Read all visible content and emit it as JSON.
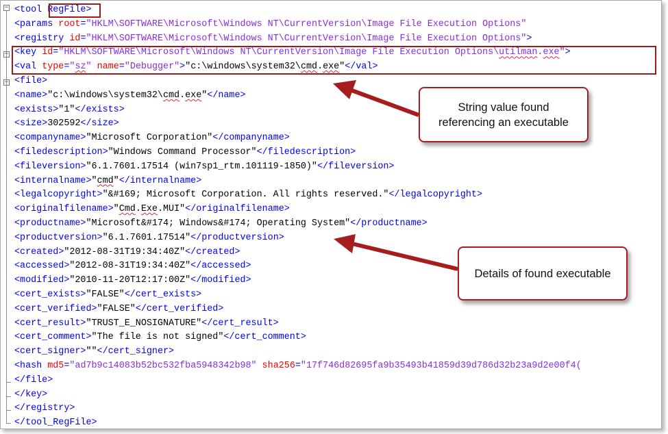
{
  "lines": [
    [
      [
        "t",
        "<tool "
      ],
      [
        "hl",
        "RegFile"
      ],
      [
        "t",
        ">"
      ]
    ],
    [
      [
        "t",
        "<params "
      ],
      [
        "a",
        "root"
      ],
      [
        "t",
        "="
      ],
      [
        "v",
        "\"HKLM\\SOFTWARE\\Microsoft\\Windows NT\\CurrentVersion\\Image File Execution Options\""
      ]
    ],
    [
      [
        "t",
        "<registry "
      ],
      [
        "a",
        "id"
      ],
      [
        "t",
        "="
      ],
      [
        "v",
        "\"HKLM\\SOFTWARE\\Microsoft\\Windows NT\\CurrentVersion\\Image File Execution Options\""
      ],
      [
        "t",
        ">"
      ]
    ],
    [
      [
        "t",
        "<key "
      ],
      [
        "a",
        "id"
      ],
      [
        "t",
        "="
      ],
      [
        "v",
        "\"HKLM\\SOFTWARE\\Microsoft\\Windows NT\\CurrentVersion\\Image File Execution Options\\"
      ],
      [
        "vw",
        "utilman"
      ],
      [
        "v",
        "."
      ],
      [
        "vw",
        "exe"
      ],
      [
        "v",
        "\""
      ],
      [
        "t",
        ">"
      ]
    ],
    [
      [
        "t",
        "<val "
      ],
      [
        "a",
        "type"
      ],
      [
        "t",
        "="
      ],
      [
        "v",
        "\""
      ],
      [
        "vw",
        "sz"
      ],
      [
        "v",
        "\" "
      ],
      [
        "a",
        "name"
      ],
      [
        "t",
        "="
      ],
      [
        "v",
        "\"Debugger\""
      ],
      [
        "t",
        ">"
      ],
      [
        "x",
        "\"c:\\windows\\system32\\"
      ],
      [
        "xw",
        "cmd"
      ],
      [
        "x",
        "."
      ],
      [
        "xw",
        "exe"
      ],
      [
        "x",
        "\""
      ],
      [
        "t",
        "</val>"
      ]
    ],
    [
      [
        "t",
        "<file>"
      ]
    ],
    [
      [
        "t",
        "<name>"
      ],
      [
        "x",
        "\"c:\\windows\\system32\\"
      ],
      [
        "xw",
        "cmd"
      ],
      [
        "x",
        "."
      ],
      [
        "xw",
        "exe"
      ],
      [
        "x",
        "\""
      ],
      [
        "t",
        "</name>"
      ]
    ],
    [
      [
        "t",
        "<exists>"
      ],
      [
        "x",
        "\"1\""
      ],
      [
        "t",
        "</exists>"
      ]
    ],
    [
      [
        "t",
        "<size>"
      ],
      [
        "x",
        "302592"
      ],
      [
        "t",
        "</size>"
      ]
    ],
    [
      [
        "t",
        "<companyname>"
      ],
      [
        "x",
        "\"Microsoft Corporation\""
      ],
      [
        "t",
        "</companyname>"
      ]
    ],
    [
      [
        "t",
        "<filedescription>"
      ],
      [
        "x",
        "\"Windows Command Processor\""
      ],
      [
        "t",
        "</filedescription>"
      ]
    ],
    [
      [
        "t",
        "<fileversion>"
      ],
      [
        "x",
        "\"6.1.7601.17514 (win7sp1_rtm.101119-1850)\""
      ],
      [
        "t",
        "</fileversion>"
      ]
    ],
    [
      [
        "t",
        "<internalname>"
      ],
      [
        "x",
        "\""
      ],
      [
        "xw",
        "cmd"
      ],
      [
        "x",
        "\""
      ],
      [
        "t",
        "</internalname>"
      ]
    ],
    [
      [
        "t",
        "<legalcopyright>"
      ],
      [
        "x",
        "\"&#169; Microsoft Corporation. All rights reserved.\""
      ],
      [
        "t",
        "</legalcopyright>"
      ]
    ],
    [
      [
        "t",
        "<originalfilename>"
      ],
      [
        "x",
        "\""
      ],
      [
        "xw",
        "Cmd"
      ],
      [
        "x",
        "."
      ],
      [
        "xw",
        "Exe"
      ],
      [
        "x",
        ".MUI\""
      ],
      [
        "t",
        "</originalfilename>"
      ]
    ],
    [
      [
        "t",
        "<productname>"
      ],
      [
        "x",
        "\"Microsoft&#174; Windows&#174; Operating System\""
      ],
      [
        "t",
        "</productname>"
      ]
    ],
    [
      [
        "t",
        "<productversion>"
      ],
      [
        "x",
        "\"6.1.7601.17514\""
      ],
      [
        "t",
        "</productversion>"
      ]
    ],
    [
      [
        "t",
        "<created>"
      ],
      [
        "x",
        "\"2012-08-31T19:34:40Z\""
      ],
      [
        "t",
        "</created>"
      ]
    ],
    [
      [
        "t",
        "<accessed>"
      ],
      [
        "x",
        "\"2012-08-31T19:34:40Z\""
      ],
      [
        "t",
        "</accessed>"
      ]
    ],
    [
      [
        "t",
        "<modified>"
      ],
      [
        "x",
        "\"2010-11-20T12:17:00Z\""
      ],
      [
        "t",
        "</modified>"
      ]
    ],
    [
      [
        "t",
        "<cert_exists>"
      ],
      [
        "x",
        "\"FALSE\""
      ],
      [
        "t",
        "</cert_exists>"
      ]
    ],
    [
      [
        "t",
        "<cert_verified>"
      ],
      [
        "x",
        "\"FALSE\""
      ],
      [
        "t",
        "</cert_verified>"
      ]
    ],
    [
      [
        "t",
        "<cert_result>"
      ],
      [
        "x",
        "\"TRUST_E_NOSIGNATURE\""
      ],
      [
        "t",
        "</cert_result>"
      ]
    ],
    [
      [
        "t",
        "<cert_comment>"
      ],
      [
        "x",
        "\"The file is not signed\""
      ],
      [
        "t",
        "</cert_comment>"
      ]
    ],
    [
      [
        "t",
        "<cert_signer>"
      ],
      [
        "x",
        "\"\""
      ],
      [
        "t",
        "</cert_signer>"
      ]
    ],
    [
      [
        "t",
        "<hash "
      ],
      [
        "a",
        "md5"
      ],
      [
        "t",
        "="
      ],
      [
        "v",
        "\"ad7b9c14083b52bc532fba5948342b98\""
      ],
      [
        "x",
        " "
      ],
      [
        "a",
        "sha256"
      ],
      [
        "t",
        "="
      ],
      [
        "v",
        "\"17f746d82695fa9b35493b41859d39d786d32b23a9d2e00f4("
      ]
    ],
    [
      [
        "t",
        "</file>"
      ]
    ],
    [
      [
        "t",
        "</key>"
      ]
    ],
    [
      [
        "t",
        "</registry>"
      ]
    ],
    [
      [
        "t",
        "</tool_RegFile>"
      ]
    ]
  ],
  "callouts": {
    "string_value": "String value found referencing an executable",
    "details": "Details of found executable"
  },
  "fold_markers": {
    "collapse": "−"
  },
  "colors": {
    "tag": "#0000ee",
    "attribute": "#ee0000",
    "attribute_value": "#8a2be2",
    "text": "#000000",
    "highlight_border": "#9b1b1b",
    "arrow": "#a51d1d"
  }
}
